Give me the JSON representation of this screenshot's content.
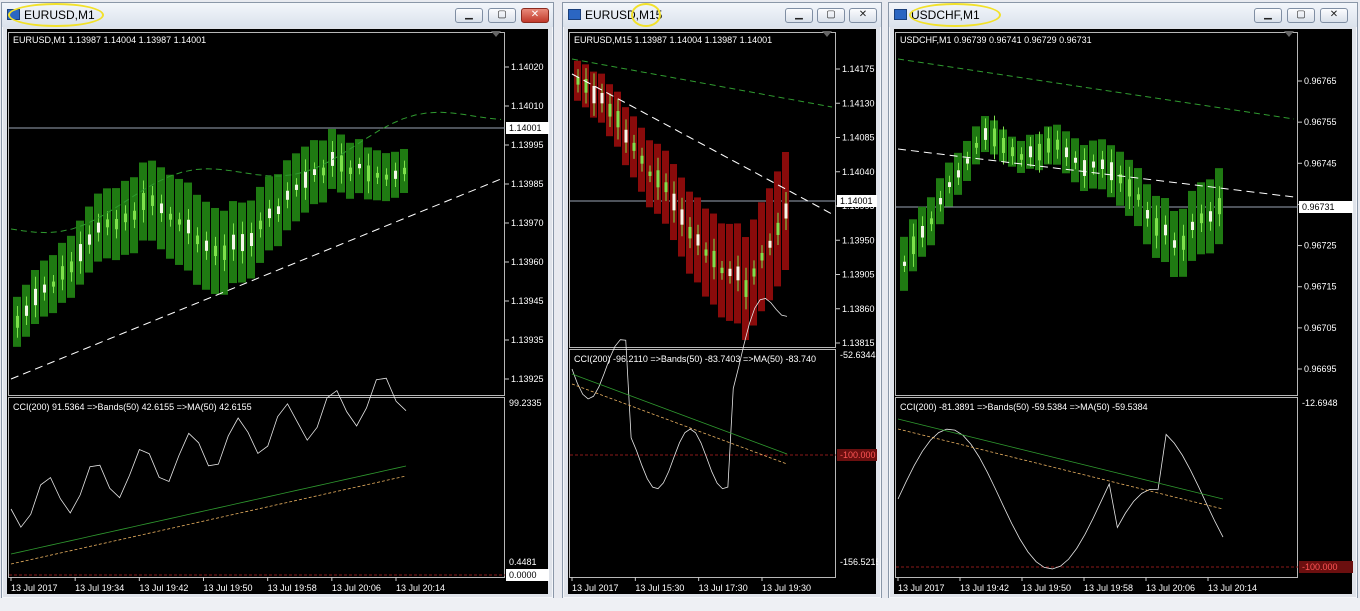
{
  "windows": [
    {
      "title": "EURUSD,M1",
      "info": "EURUSD,M1  1.13987 1.14004 1.13987 1.14001",
      "price_ticks": [
        "1.14020",
        "1.14010",
        "1.13995",
        "1.13985",
        "1.13970",
        "1.13960",
        "1.13945",
        "1.13935",
        "1.13925"
      ],
      "current_price": "1.14001",
      "cci_label": "CCI(200) 91.5364  =>Bands(50) 42.6155  =>MA(50) 42.6155",
      "cci_ticks": [
        "99.2335",
        "0.4481"
      ],
      "cci_current": "0.0000",
      "time_ticks": [
        "13 Jul 2017",
        "13 Jul 19:34",
        "13 Jul 19:42",
        "13 Jul 19:50",
        "13 Jul 19:58",
        "13 Jul 20:06",
        "13 Jul 20:14"
      ],
      "candle_color": "#1f7a12",
      "buttons": {
        "minimize": "▁",
        "maximize": "▢",
        "close": "✕"
      }
    },
    {
      "title": "EURUSD,M15",
      "info": "EURUSD,M15  1.13987 1.14004 1.13987 1.14001",
      "price_ticks": [
        "1.14175",
        "1.14130",
        "1.14085",
        "1.14040",
        "1.13995",
        "1.13950",
        "1.13905",
        "1.13860",
        "1.13815"
      ],
      "current_price": "1.14001",
      "cci_label": "CCI(200) -96.2110  =>Bands(50) -83.7403  =>MA(50) -83.740",
      "cci_ticks": [
        "-52.6344",
        "-156.5215"
      ],
      "cci_current": "-100.000",
      "time_ticks": [
        "13 Jul 2017",
        "13 Jul 15:30",
        "13 Jul 17:30",
        "13 Jul 19:30"
      ],
      "candle_color": "#8a0b0b",
      "buttons": {
        "minimize": "▁",
        "maximize": "▢",
        "close": "✕"
      }
    },
    {
      "title": "USDCHF,M1",
      "info": "USDCHF,M1  0.96739 0.96741 0.96729 0.96731",
      "price_ticks": [
        "0.96765",
        "0.96755",
        "0.96745",
        "0.96735",
        "0.96725",
        "0.96715",
        "0.96705",
        "0.96695"
      ],
      "current_price": "0.96731",
      "cci_label": "CCI(200) -81.3891  =>Bands(50) -59.5384  =>MA(50) -59.5384",
      "cci_ticks": [
        "-12.6948"
      ],
      "cci_current": "-100.000",
      "time_ticks": [
        "13 Jul 2017",
        "13 Jul 19:42",
        "13 Jul 19:50",
        "13 Jul 19:58",
        "13 Jul 20:06",
        "13 Jul 20:14"
      ],
      "candle_color": "#1f7a12",
      "buttons": {
        "minimize": "▁",
        "maximize": "▢",
        "close": "✕"
      }
    }
  ]
}
